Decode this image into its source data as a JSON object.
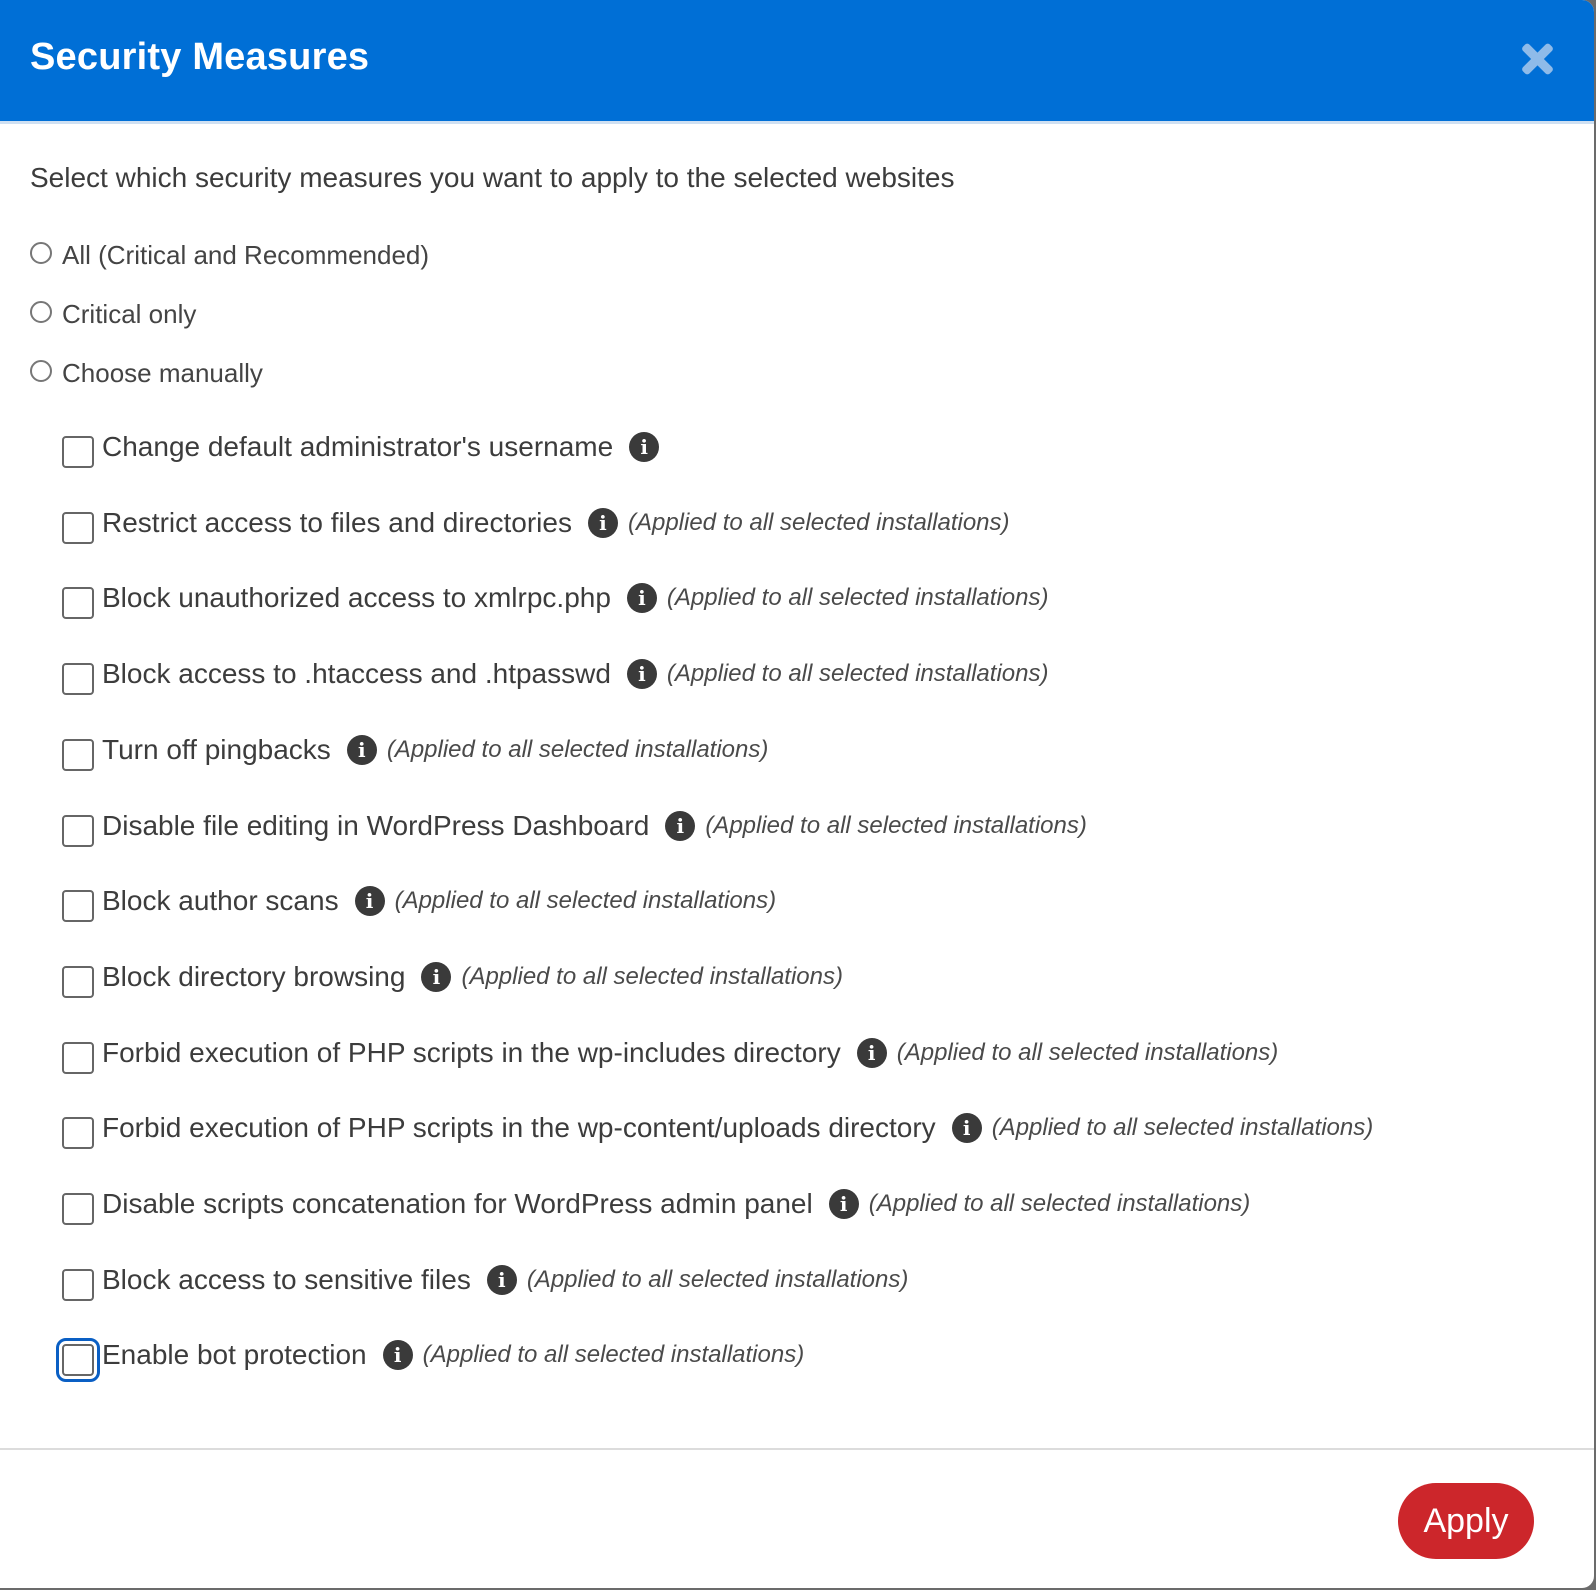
{
  "dialog": {
    "title": "Security Measures",
    "close_icon": "close-icon",
    "intro": "Select which security measures you want to apply to the selected websites",
    "radio_options": [
      {
        "label": "All (Critical and Recommended)",
        "selected": false
      },
      {
        "label": "Critical only",
        "selected": false
      },
      {
        "label": "Choose manually",
        "selected": false
      }
    ],
    "measures": [
      {
        "label": "Change default administrator's username",
        "note": "",
        "checked": false
      },
      {
        "label": "Restrict access to files and directories",
        "note": "(Applied to all selected installations)",
        "checked": false
      },
      {
        "label": "Block unauthorized access to xmlrpc.php",
        "note": "(Applied to all selected installations)",
        "checked": false
      },
      {
        "label": "Block access to .htaccess and .htpasswd",
        "note": "(Applied to all selected installations)",
        "checked": false
      },
      {
        "label": "Turn off pingbacks",
        "note": "(Applied to all selected installations)",
        "checked": false
      },
      {
        "label": "Disable file editing in WordPress Dashboard",
        "note": "(Applied to all selected installations)",
        "checked": false
      },
      {
        "label": "Block author scans",
        "note": "(Applied to all selected installations)",
        "checked": false
      },
      {
        "label": "Block directory browsing",
        "note": "(Applied to all selected installations)",
        "checked": false
      },
      {
        "label": "Forbid execution of PHP scripts in the wp-includes directory",
        "note": "(Applied to all selected installations)",
        "checked": false
      },
      {
        "label": "Forbid execution of PHP scripts in the wp-content/uploads directory",
        "note": "(Applied to all selected installations)",
        "checked": false
      },
      {
        "label": "Disable scripts concatenation for WordPress admin panel",
        "note": "(Applied to all selected installations)",
        "checked": false
      },
      {
        "label": "Block access to sensitive files",
        "note": "(Applied to all selected installations)",
        "checked": false
      },
      {
        "label": "Enable bot protection",
        "note": "(Applied to all selected installations)",
        "checked": false,
        "focused": true
      }
    ],
    "info_glyph": "i",
    "apply_label": "Apply",
    "colors": {
      "header": "#006fd6",
      "apply": "#cc262b"
    }
  }
}
